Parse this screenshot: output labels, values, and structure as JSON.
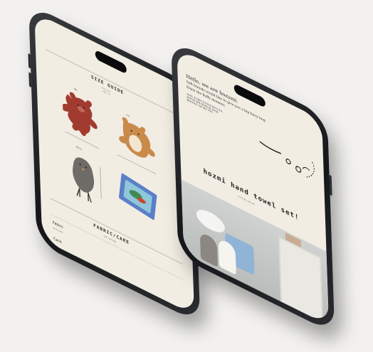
{
  "left_screen": {
    "size_guide_title": "SIZE GUIDE",
    "size_guide_sub1": "사이즈 안내",
    "size_guide_sub2": "단위: cm",
    "items": [
      {
        "label": "<B>",
        "name": "bear"
      },
      {
        "label": "<S>",
        "name": "squirrel"
      },
      {
        "label": "<B/S>",
        "name": "bird"
      },
      {
        "label": "",
        "name": "towel-pack"
      }
    ],
    "fabric_title": "FABRIC/CARE",
    "fabric_sub": "소재 / 세탁 방법",
    "fabric_label": "Fabric",
    "fabric_value": "@ 면 100%",
    "care_label": "Care"
  },
  "right_screen": {
    "greeting_line1": "Hello, we are hozumi.",
    "greeting_line2": "Soft friends would like to give you a big furry hug.",
    "greeting_line3": "Enjoy the fluffy moment.",
    "korean_line1": "귀여운 친구들이 포근하게 안아드려요.",
    "korean_line2": "호주미와 함께 폭신폭신한 순간을",
    "korean_line3": "즐겨보세요 기분 좋은 하루!",
    "headline": "hozmi hand towel set!",
    "headline_sub": "호주미 핸드 타월 세트"
  },
  "colors": {
    "screen_bg": "#f1ede3",
    "bear": "#a23b2f",
    "squirrel": "#c98a4a",
    "bird": "#6f6b67",
    "towel_blue": "#5a7fc8"
  }
}
